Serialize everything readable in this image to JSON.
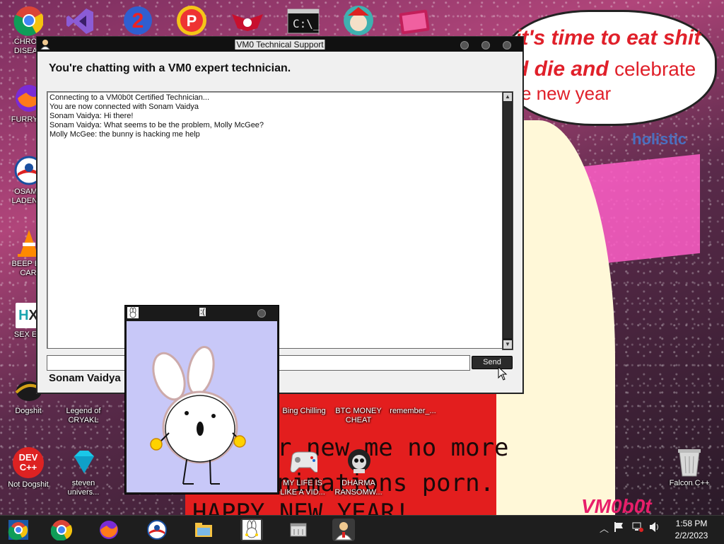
{
  "desktop": {
    "wallpaper": {
      "speech_line1": "it's time to eat shit",
      "speech_line2_bold": "d die and",
      "speech_line2_normal": "celebrate",
      "speech_line3": "e new year",
      "banner": "holistic",
      "red_text_1": "r new me no more",
      "red_text_2": "nimations porn.",
      "red_text_3": "HAPPY NEW YEAR!",
      "signature": "VM0b0t"
    },
    "icons": [
      {
        "label": "CHRON\nDISEAS",
        "icon": "chrome-icon"
      },
      {
        "label": "FURRY C",
        "icon": "firefox-icon"
      },
      {
        "label": "OSAMA\nLADEN E",
        "icon": "obama-icon"
      },
      {
        "label": "BEEP BE\nCAR",
        "icon": "traffic-cone-icon"
      },
      {
        "label": "SEX ED",
        "icon": "hx-icon"
      },
      {
        "label": "Dogshit",
        "icon": "dogshit-icon"
      },
      {
        "label": "Not Dogshit",
        "icon": "devcpp-icon"
      },
      {
        "label": "Legend of\nCRYAKL",
        "icon": "cryakl-icon"
      },
      {
        "label": "steven\nunivers...",
        "icon": "diamond-icon"
      },
      {
        "label": "Bing Chilling",
        "icon": "bing-icon"
      },
      {
        "label": "BTC MONEY\nCHEAT",
        "icon": "btc-icon"
      },
      {
        "label": "remember_...",
        "icon": "remember-icon"
      },
      {
        "label": "MY LIFE IS\nLIKE A VID...",
        "icon": "gamepad-icon"
      },
      {
        "label": "DHARMA\nRANSOMW...",
        "icon": "skull-icon"
      },
      {
        "label": "Falcon C++",
        "icon": "recycle-bin-icon"
      }
    ]
  },
  "main_window": {
    "title": "VM0 Technical Support",
    "headline": "You're chatting with a VM0 expert technician.",
    "chat_lines": [
      "Connecting to a VM0b0t Certified Technician...",
      "You are now connected with Sonam Vaidya",
      "Sonam Vaidya: Hi there!",
      "Sonam Vaidya: What seems to be the problem, Molly McGee?",
      "Molly McGee: the bunny is hacking me help"
    ],
    "message_value": "",
    "send_label": "Send",
    "status_text": "Sonam Vaidya"
  },
  "bunny_window": {
    "title": ":("
  },
  "taskbar": {
    "clock_time": "1:58 PM",
    "clock_date": "2/2/2023"
  }
}
